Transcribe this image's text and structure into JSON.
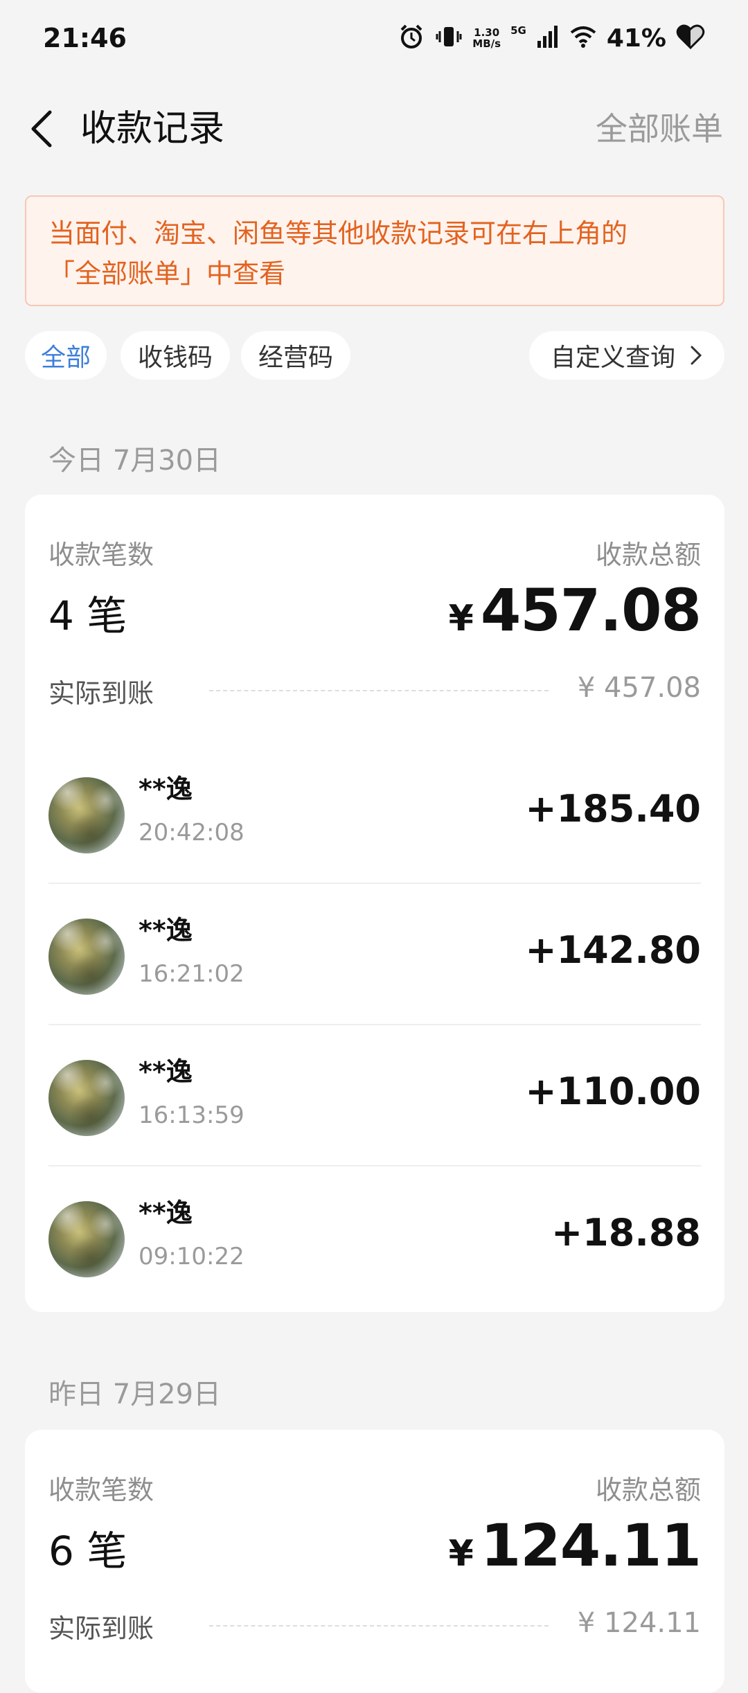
{
  "status_bar": {
    "time": "21:46",
    "net_speed_value": "1.30",
    "net_speed_unit": "MB/s",
    "network": "5G",
    "battery": "41%",
    "icons": [
      "alarm-icon",
      "vibrate-icon",
      "signal-icon",
      "wifi-icon",
      "heart-battery-icon"
    ]
  },
  "header": {
    "title": "收款记录",
    "right_link": "全部账单"
  },
  "notice": {
    "text_line1": "当面付、淘宝、闲鱼等其他收款记录可在右上角的",
    "text_line2": "「全部账单」中查看"
  },
  "filters": {
    "all": "全部",
    "qr": "收钱码",
    "business": "经营码",
    "custom": "自定义查询",
    "active": "全部"
  },
  "days": [
    {
      "date_label": "今日 7月30日",
      "count_label": "收款笔数",
      "count_value": "4 笔",
      "total_label": "收款总额",
      "currency": "¥",
      "total_value": "457.08",
      "actual_label": "实际到账",
      "actual_value": "¥ 457.08",
      "transactions": [
        {
          "name": "**逸",
          "time": "20:42:08",
          "amount": "+185.40"
        },
        {
          "name": "**逸",
          "time": "16:21:02",
          "amount": "+142.80"
        },
        {
          "name": "**逸",
          "time": "16:13:59",
          "amount": "+110.00"
        },
        {
          "name": "**逸",
          "time": "09:10:22",
          "amount": "+18.88"
        }
      ]
    },
    {
      "date_label": "昨日 7月29日",
      "count_label": "收款笔数",
      "count_value": "6 笔",
      "total_label": "收款总额",
      "currency": "¥",
      "total_value": "124.11",
      "actual_label": "实际到账",
      "actual_value": "¥ 124.11",
      "transactions": []
    }
  ],
  "colors": {
    "accent": "#3d7fdb",
    "notice_text": "#e2631f",
    "notice_bg": "#fff3ee",
    "page_bg": "#f4f4f4"
  }
}
